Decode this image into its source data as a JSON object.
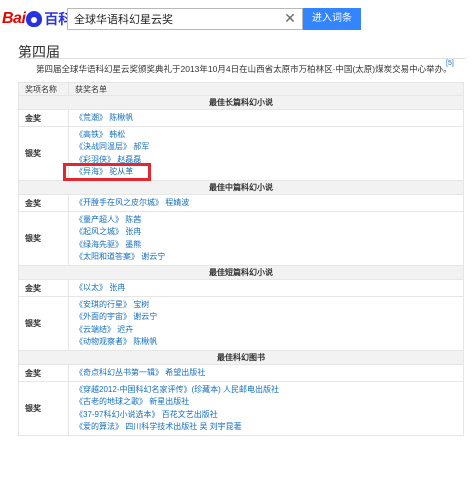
{
  "header": {
    "logo": {
      "bai": "Bai",
      "baike": "百科"
    },
    "search": {
      "value": "全球华语科幻星云奖",
      "placeholder": ""
    },
    "clear_glyph": "✕",
    "search_button": "进入词条"
  },
  "section": {
    "title": "第四届",
    "intro": "第四届全球华语科幻星云奖颁奖典礼于2013年10月4日在山西省太原市万柏林区·中国(太原)煤炭交易中心举办。",
    "citation": "[5]"
  },
  "table": {
    "headers": [
      "奖项名称",
      "获奖名单"
    ],
    "categories": [
      {
        "name": "最佳长篇科幻小说",
        "rows": [
          {
            "award": "金奖",
            "entries": [
              {
                "work": "《荒潮》",
                "author": "陈楸帆"
              }
            ]
          },
          {
            "award": "银奖",
            "entries": [
              {
                "work": "《高铁》",
                "author": "韩松"
              },
              {
                "work": "《決战同温层》",
                "author": "郝军"
              },
              {
                "work": "《彩羽侠》",
                "author": "赵磊磊"
              },
              {
                "work": "《异海》",
                "author": "驼从革"
              }
            ]
          }
        ]
      },
      {
        "name": "最佳中篇科幻小说",
        "rows": [
          {
            "award": "金奖",
            "entries": [
              {
                "work": "《开膛手在风之皮尔城》",
                "author": "程婧波"
              }
            ]
          },
          {
            "award": "银奖",
            "entries": [
              {
                "work": "《量产超人》",
                "author": "陈茜"
              },
              {
                "work": "《起风之城》",
                "author": "张冉"
              },
              {
                "work": "《绿海先驱》",
                "author": "墨熊"
              },
              {
                "work": "《太阳和道答案》",
                "author": "谢云宁"
              }
            ]
          }
        ]
      },
      {
        "name": "最佳短篇科幻小说",
        "rows": [
          {
            "award": "金奖",
            "entries": [
              {
                "work": "《以太》",
                "author": "张冉"
              }
            ]
          },
          {
            "award": "银奖",
            "entries": [
              {
                "work": "《安琪的行星》",
                "author": "宝树"
              },
              {
                "work": "《外面的宇宙》",
                "author": "谢云宁"
              },
              {
                "work": "《云端结》",
                "author": "迟卉"
              },
              {
                "work": "《动物观察者》",
                "author": "陈楸帆"
              }
            ]
          }
        ]
      },
      {
        "name": "最佳科幻图书",
        "rows": [
          {
            "award": "金奖",
            "entries": [
              {
                "work": "《奇点科幻丛书第一辑》",
                "author": "希望出版社"
              }
            ]
          },
          {
            "award": "银奖",
            "entries": [
              {
                "work": "《穿越2012-中国科幻名家评传》(珍藏本)",
                "author": "人民邮电出版社"
              },
              {
                "work": "《古老的地球之歌》",
                "author": "新星出版社"
              },
              {
                "work": "《37-97科幻小说选本》",
                "author": "百花文艺出版社"
              },
              {
                "work": "《爱的算法》",
                "author": "四川科学技术出版社 吴 刘宇昆著"
              }
            ]
          }
        ]
      }
    ]
  },
  "colors": {
    "link": "#136ec2",
    "highlight": "#e3262f",
    "button": "#3385ff",
    "logo_red": "#e10601",
    "logo_blue": "#2932e1"
  }
}
